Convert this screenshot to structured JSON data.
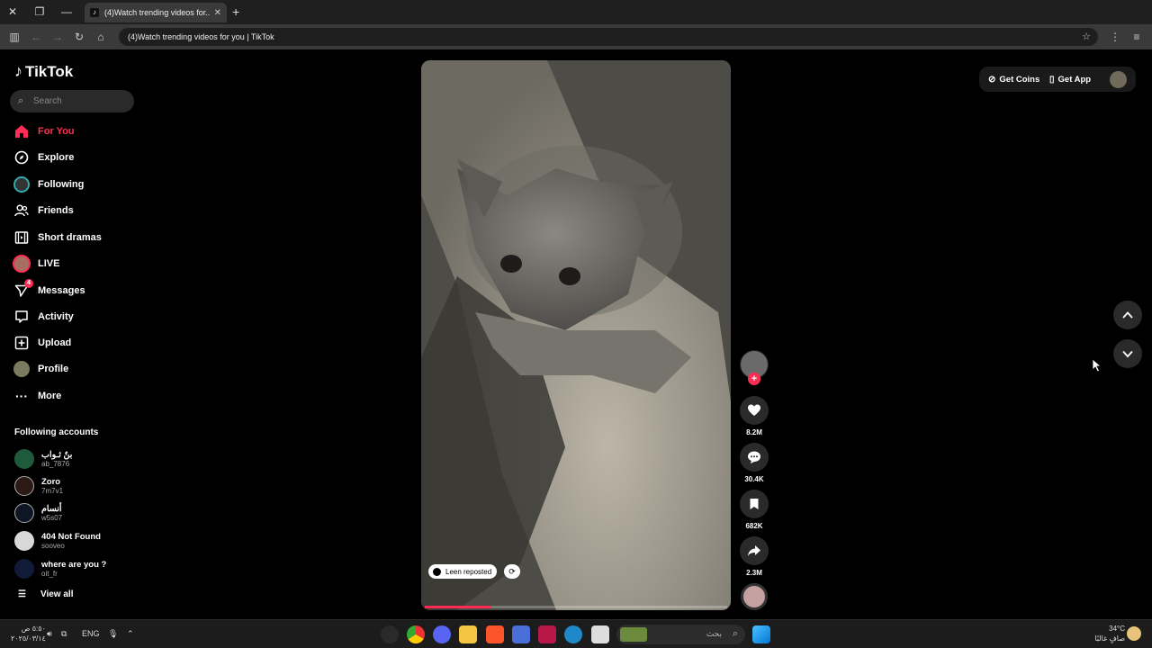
{
  "browser": {
    "tab_title": "(4)Watch trending videos for...",
    "address": "(4)Watch trending videos for you | TikTok"
  },
  "sidebar": {
    "logo": "TikTok",
    "search_placeholder": "Search",
    "nav": [
      {
        "label": "For You",
        "icon": "home-icon",
        "active": true
      },
      {
        "label": "Explore",
        "icon": "compass-icon"
      },
      {
        "label": "Following",
        "icon": "following-avatar-icon"
      },
      {
        "label": "Friends",
        "icon": "friends-icon"
      },
      {
        "label": "Short dramas",
        "icon": "film-icon"
      },
      {
        "label": "LIVE",
        "icon": "live-avatar-icon"
      },
      {
        "label": "Messages",
        "icon": "paper-plane-icon",
        "badge": "4"
      },
      {
        "label": "Activity",
        "icon": "activity-icon"
      },
      {
        "label": "Upload",
        "icon": "upload-icon"
      },
      {
        "label": "Profile",
        "icon": "profile-avatar-icon"
      },
      {
        "label": "More",
        "icon": "more-icon"
      }
    ],
    "following_title": "Following accounts",
    "accounts": [
      {
        "name": "بنٌ ثـواب",
        "username": "ab_7876",
        "color": "#1f5a3c"
      },
      {
        "name": "Zoro",
        "username": "7m7v1",
        "color": "#2b1a14"
      },
      {
        "name": "أنسام",
        "username": "w5s07",
        "color": "#0e1624"
      },
      {
        "name": "404 Not Found",
        "username": "sooveo",
        "color": "#d8d8d8"
      },
      {
        "name": "where are you ?",
        "username": "oit_fr",
        "color": "#121a3a"
      }
    ],
    "view_all": "View all"
  },
  "video": {
    "repost_label": "Leen reposted",
    "progress": 0.22
  },
  "actions": {
    "likes": "8.2M",
    "comments": "30.4K",
    "saves": "682K",
    "shares": "2.3M"
  },
  "topbar": {
    "get_coins": "Get Coins",
    "get_app": "Get App"
  },
  "taskbar": {
    "time": "٥:٥٠ ص",
    "date": "٢٠٢٥/٠٣/١٤",
    "lang": "ENG",
    "search_label": "بحث",
    "temp": "34°C",
    "weather": "صافٍ غالبًا"
  },
  "colors": {
    "accent": "#fe2c55",
    "background": "#000000"
  }
}
